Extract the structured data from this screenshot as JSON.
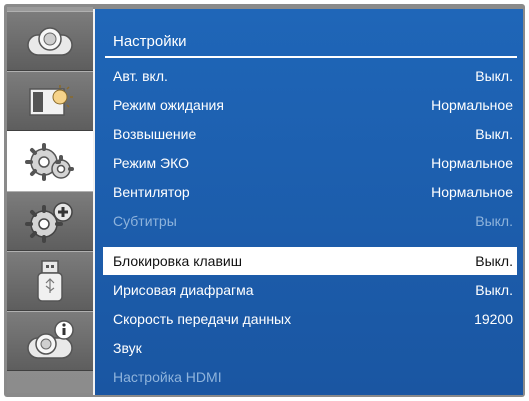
{
  "sidebar": {
    "tabs": [
      {
        "icon": "projector-icon"
      },
      {
        "icon": "display-adjust-icon"
      },
      {
        "icon": "settings-gears-icon",
        "active": true
      },
      {
        "icon": "extended-settings-icon"
      },
      {
        "icon": "usb-icon"
      },
      {
        "icon": "projector-info-icon"
      }
    ]
  },
  "menu": {
    "title": "Настройки",
    "items": [
      {
        "label": "Авт. вкл.",
        "value": "Выкл.",
        "state": "normal"
      },
      {
        "label": "Режим ожидания",
        "value": "Нормальное",
        "state": "normal"
      },
      {
        "label": "Возвышение",
        "value": "Выкл.",
        "state": "normal"
      },
      {
        "label": "Режим ЭКО",
        "value": "Нормальное",
        "state": "normal"
      },
      {
        "label": "Вентилятор",
        "value": "Нормальное",
        "state": "normal"
      },
      {
        "label": "Субтитры",
        "value": "Выкл.",
        "state": "disabled"
      },
      {
        "label": "Блокировка клавиш",
        "value": "Выкл.",
        "state": "selected"
      },
      {
        "label": "Ирисовая диафрагма",
        "value": "Выкл.",
        "state": "normal"
      },
      {
        "label": "Скорость передачи данных",
        "value": "19200",
        "state": "normal"
      },
      {
        "label": "Звук",
        "value": "",
        "state": "normal"
      },
      {
        "label": "Настройка HDMI",
        "value": "",
        "state": "disabled"
      }
    ]
  },
  "colors": {
    "panel": "#1a5fb0",
    "highlight": "#ffffff",
    "disabled_text": "#8fb4dc"
  }
}
